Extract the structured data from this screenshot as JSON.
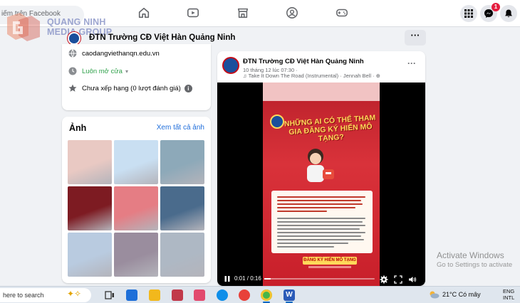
{
  "browser": {
    "search_placeholder": "iếm trên Facebook"
  },
  "watermark": {
    "line1": "QUANG NINH",
    "line2": "MEDIA GROUP"
  },
  "nav": {
    "icons": [
      "home-icon",
      "video-icon",
      "marketplace-icon",
      "groups-icon",
      "gaming-icon"
    ],
    "notification_count": "1"
  },
  "page": {
    "name": "ĐTN Trường CĐ Việt Hàn Quảng Ninh",
    "more_label": "···"
  },
  "intro": {
    "website": "caodangviethanqn.edu.vn",
    "hours": "Luôn mở cửa",
    "rating": "Chưa xếp hạng (0 lượt đánh giá)"
  },
  "photos": {
    "title": "Ảnh",
    "see_all": "Xem tất cả ảnh",
    "thumb_colors": [
      "#e9c9c3",
      "#c9dff2",
      "#8da9b9",
      "#7d1b22",
      "#e57d84",
      "#4a6b8c",
      "#b9cbe0",
      "#9a8d9e",
      "#aeb8c4"
    ]
  },
  "post": {
    "author": "ĐTN Trường CĐ Việt Hàn Quảng Ninh",
    "date": "10 tháng 12 lúc 07:30 ·",
    "music": "♫ Take It Down The Road (Instrumental) · Jennah Bell · ⊕",
    "more_label": "···",
    "poster_headline": "NHỮNG AI CÓ THỂ THAM GIA ĐĂNG KÝ HIẾN MÔ TẠNG?",
    "poster_button": "ĐĂNG KÝ HIẾN MÔ TẠNG",
    "video_time": "0:01 / 0:16",
    "video_progress": 0.06
  },
  "windows": {
    "activate_title": "Activate Windows",
    "activate_sub": "Go to Settings to activate"
  },
  "taskbar": {
    "search_text": "here to search",
    "temperature": "21°C  Có mây",
    "lang_line1": "ENG",
    "lang_line2": "INTL"
  }
}
